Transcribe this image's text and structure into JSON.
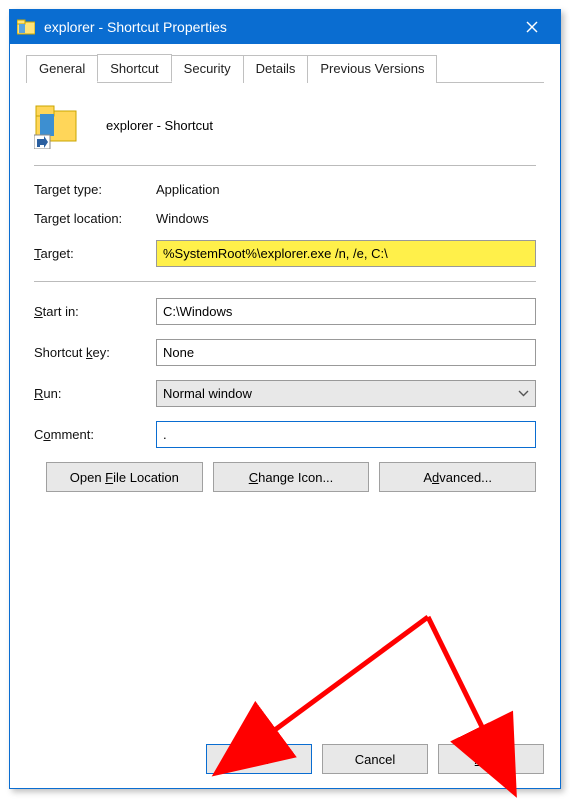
{
  "title": "explorer - Shortcut Properties",
  "tabs": [
    "General",
    "Shortcut",
    "Security",
    "Details",
    "Previous Versions"
  ],
  "active_tab_index": 1,
  "shortcut": {
    "name": "explorer - Shortcut",
    "target_type_label": "Target type:",
    "target_type": "Application",
    "target_location_label": "Target location:",
    "target_location": "Windows",
    "target_label_pre": "",
    "target_label_u": "T",
    "target_label_post": "arget:",
    "target_value": "%SystemRoot%\\explorer.exe /n, /e, C:\\",
    "startin_label_u": "S",
    "startin_label_post": "tart in:",
    "startin_value": "C:\\Windows",
    "shortcutkey_label_pre": "Shortcut ",
    "shortcutkey_label_u": "k",
    "shortcutkey_label_post": "ey:",
    "shortcutkey_value": "None",
    "run_label_u": "R",
    "run_label_post": "un:",
    "run_value": "Normal window",
    "comment_label_pre": "C",
    "comment_label_u": "o",
    "comment_label_post": "mment:",
    "comment_value": ".",
    "open_file_pre": "Open ",
    "open_file_u": "F",
    "open_file_post": "ile Location",
    "change_icon_u": "C",
    "change_icon_post": "hange Icon...",
    "advanced_pre": "A",
    "advanced_u": "d",
    "advanced_post": "vanced..."
  },
  "footer": {
    "ok": "OK",
    "cancel": "Cancel",
    "apply_u": "A",
    "apply_post": "pply"
  }
}
